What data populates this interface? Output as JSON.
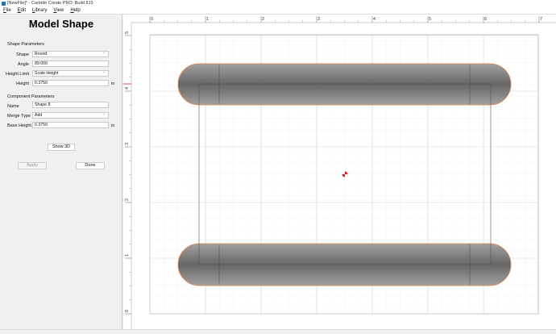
{
  "window": {
    "title": "[NewFile]* - Carbide Create PRO: Build 815"
  },
  "menu": [
    {
      "label": "File",
      "underline": "F",
      "rest": "ile"
    },
    {
      "label": "Edit",
      "underline": "E",
      "rest": "dit"
    },
    {
      "label": "Library",
      "underline": "L",
      "rest": "ibrary"
    },
    {
      "label": "View",
      "underline": "V",
      "rest": "iew"
    },
    {
      "label": "Help",
      "underline": "H",
      "rest": "elp"
    }
  ],
  "panel": {
    "title": "Model Shape",
    "shape_params_label": "Shape Parameters",
    "shape": {
      "label": "Shape",
      "value": "Round"
    },
    "angle": {
      "label": "Angle",
      "value": "89.000"
    },
    "height_limit": {
      "label": "Height Limit",
      "value": "Scale Height"
    },
    "height": {
      "label": "Height",
      "value": "0.3750",
      "unit": "in"
    },
    "component_params_label": "Component Parameters",
    "name": {
      "label": "Name",
      "value": "Shape 8"
    },
    "merge_type": {
      "label": "Merge Type",
      "value": "Add"
    },
    "base_height": {
      "label": "Base Height",
      "value": "0.3750",
      "unit": "in"
    },
    "show3d_label": "Show 3D",
    "apply_label": "Apply",
    "done_label": "Done"
  },
  "ruler": {
    "x_ticks": [
      "0",
      "1",
      "2",
      "3",
      "4",
      "5",
      "6",
      "7"
    ],
    "y_ticks": [
      "0",
      "1",
      "2",
      "3",
      "4",
      "5"
    ]
  },
  "colors": {
    "accent_orange": "#e8773a",
    "shape_fill": "#555555",
    "origin_marker": "#e02020"
  }
}
